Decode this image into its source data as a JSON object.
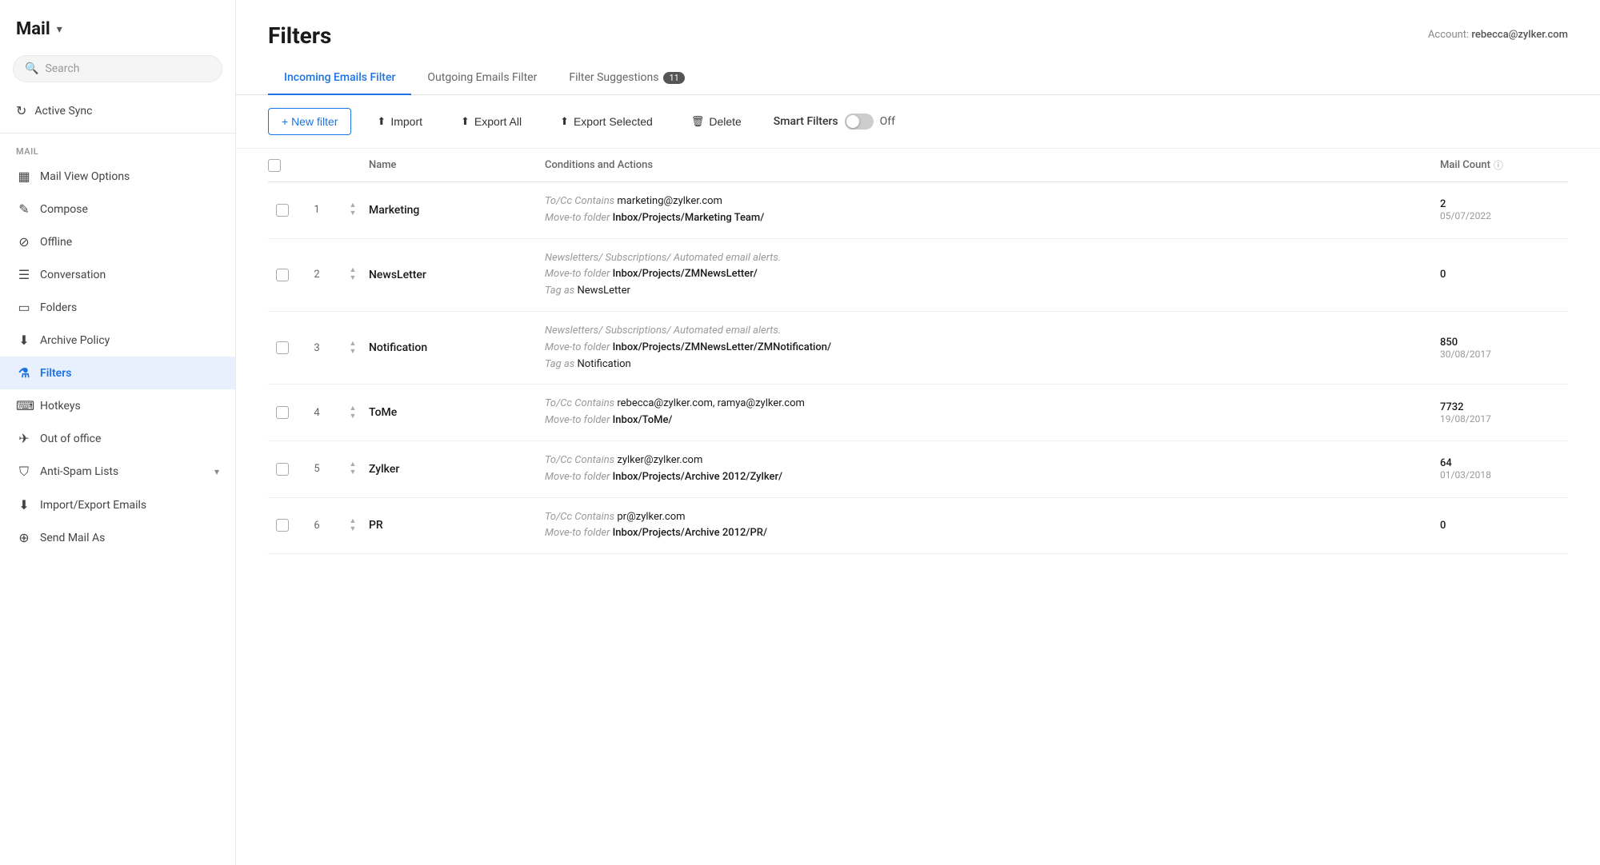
{
  "app": {
    "title": "Mail",
    "chevron": "▾"
  },
  "sidebar": {
    "search_placeholder": "Search",
    "sync_label": "Active Sync",
    "section_label": "MAIL",
    "items": [
      {
        "id": "mail-view-options",
        "icon": "▦",
        "label": "Mail View Options",
        "active": false
      },
      {
        "id": "compose",
        "icon": "✎",
        "label": "Compose",
        "active": false
      },
      {
        "id": "offline",
        "icon": "⊘",
        "label": "Offline",
        "active": false
      },
      {
        "id": "conversation",
        "icon": "☰",
        "label": "Conversation",
        "active": false
      },
      {
        "id": "folders",
        "icon": "▭",
        "label": "Folders",
        "active": false
      },
      {
        "id": "archive-policy",
        "icon": "⬇",
        "label": "Archive Policy",
        "active": false
      },
      {
        "id": "filters",
        "icon": "⚗",
        "label": "Filters",
        "active": true
      },
      {
        "id": "hotkeys",
        "icon": "⌨",
        "label": "Hotkeys",
        "active": false
      },
      {
        "id": "out-of-office",
        "icon": "✈",
        "label": "Out of office",
        "active": false
      },
      {
        "id": "anti-spam-lists",
        "icon": "⛉",
        "label": "Anti-Spam Lists",
        "active": false,
        "chevron": "▾"
      },
      {
        "id": "import-export-emails",
        "icon": "⬇",
        "label": "Import/Export Emails",
        "active": false
      },
      {
        "id": "send-mail-as",
        "icon": "⊕",
        "label": "Send Mail As",
        "active": false
      }
    ]
  },
  "page": {
    "title": "Filters",
    "account_label": "Account: ",
    "account_email": "rebecca@zylker.com"
  },
  "tabs": [
    {
      "id": "incoming",
      "label": "Incoming Emails Filter",
      "active": true,
      "badge": null
    },
    {
      "id": "outgoing",
      "label": "Outgoing Emails Filter",
      "active": false,
      "badge": null
    },
    {
      "id": "suggestions",
      "label": "Filter Suggestions",
      "active": false,
      "badge": "11"
    }
  ],
  "toolbar": {
    "new_filter": "+ New filter",
    "import": "Import",
    "export_all": "Export All",
    "export_selected": "Export Selected",
    "delete": "Delete",
    "smart_filters": "Smart Filters",
    "toggle_state": "Off"
  },
  "table": {
    "columns": {
      "name": "Name",
      "conditions": "Conditions and Actions",
      "mail_count": "Mail Count"
    },
    "rows": [
      {
        "num": 1,
        "name": "Marketing",
        "conditions": [
          {
            "label": "To/Cc Contains",
            "value": "marketing@zylker.com"
          },
          {
            "action": "Move-to folder",
            "folder": "Inbox/Projects/Marketing Team/"
          }
        ],
        "mail_count": "2",
        "date": "05/07/2022"
      },
      {
        "num": 2,
        "name": "NewsLetter",
        "conditions": [
          {
            "desc": "Newsletters/ Subscriptions/ Automated email alerts."
          },
          {
            "action": "Move-to folder",
            "folder": "Inbox/Projects/ZMNewsLetter/"
          },
          {
            "tag": "Tag as",
            "tag_value": "NewsLetter"
          }
        ],
        "mail_count": "0",
        "date": null
      },
      {
        "num": 3,
        "name": "Notification",
        "conditions": [
          {
            "desc": "Newsletters/ Subscriptions/ Automated email alerts."
          },
          {
            "action": "Move-to folder",
            "folder": "Inbox/Projects/ZMNewsLetter/ZMNotification/"
          },
          {
            "tag": "Tag as",
            "tag_value": "Notification"
          }
        ],
        "mail_count": "850",
        "date": "30/08/2017"
      },
      {
        "num": 4,
        "name": "ToMe",
        "conditions": [
          {
            "label": "To/Cc Contains",
            "value": "rebecca@zylker.com, ramya@zylker.com"
          },
          {
            "action": "Move-to folder",
            "folder": "Inbox/ToMe/"
          }
        ],
        "mail_count": "7732",
        "date": "19/08/2017"
      },
      {
        "num": 5,
        "name": "Zylker",
        "conditions": [
          {
            "label": "To/Cc Contains",
            "value": "zylker@zylker.com"
          },
          {
            "action": "Move-to folder",
            "folder": "Inbox/Projects/Archive 2012/Zylker/"
          }
        ],
        "mail_count": "64",
        "date": "01/03/2018"
      },
      {
        "num": 6,
        "name": "PR",
        "conditions": [
          {
            "label": "To/Cc Contains",
            "value": "pr@zylker.com"
          },
          {
            "action": "Move-to folder",
            "folder": "Inbox/Projects/Archive 2012/PR/"
          }
        ],
        "mail_count": "0",
        "date": null
      }
    ]
  }
}
